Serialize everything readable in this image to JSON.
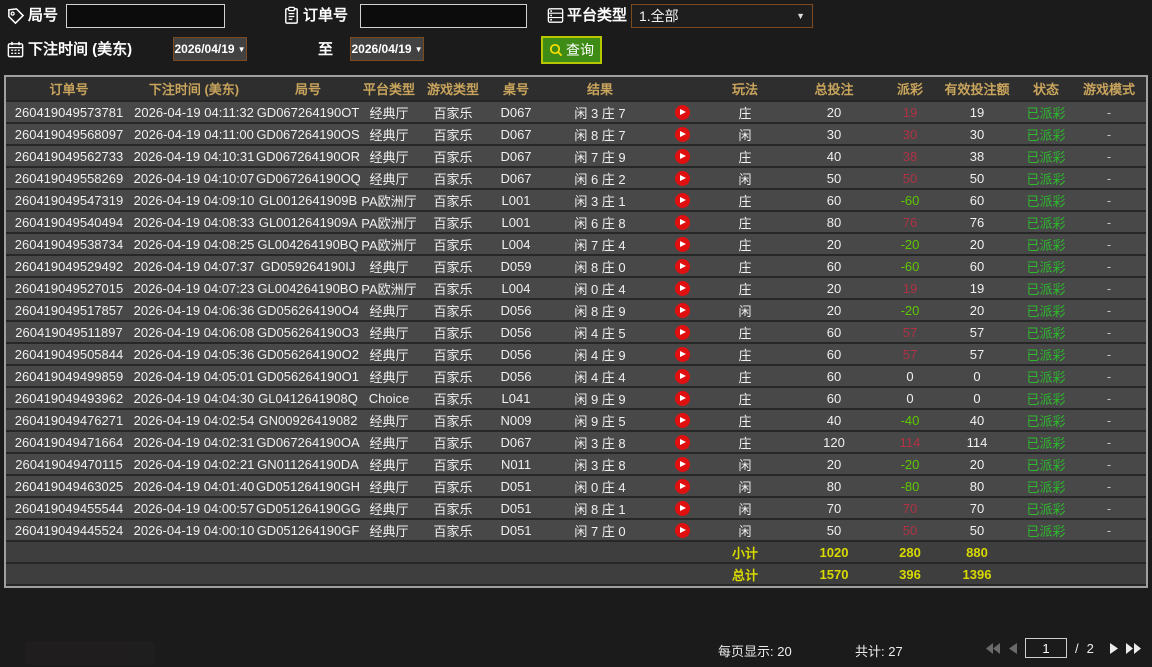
{
  "filters": {
    "game_no_label": "局号",
    "order_no_label": "订单号",
    "platform_label": "平台类型",
    "platform_value": "1.全部",
    "bet_time_label": "下注时间 (美东)",
    "date_from": "2026/04/19",
    "to_label": "至",
    "date_to": "2026/04/19",
    "query_label": "查询"
  },
  "table": {
    "columns": [
      "订单号",
      "下注时间 (美东)",
      "局号",
      "平台类型",
      "游戏类型",
      "桌号",
      "结果",
      "",
      "玩法",
      "总投注",
      "派彩",
      "有效投注额",
      "状态",
      "游戏模式"
    ],
    "rows": [
      {
        "order": "260419049573781",
        "time": "2026-04-19 04:11:32",
        "round": "GD067264190OT",
        "platform": "经典厅",
        "game": "百家乐",
        "table_no": "D067",
        "result": "闲 3 庄 7",
        "side": "庄",
        "bet": "20",
        "payout": "19",
        "valid": "19",
        "status": "已派彩",
        "mode": "-"
      },
      {
        "order": "260419049568097",
        "time": "2026-04-19 04:11:00",
        "round": "GD067264190OS",
        "platform": "经典厅",
        "game": "百家乐",
        "table_no": "D067",
        "result": "闲 8 庄 7",
        "side": "闲",
        "bet": "30",
        "payout": "30",
        "valid": "30",
        "status": "已派彩",
        "mode": "-"
      },
      {
        "order": "260419049562733",
        "time": "2026-04-19 04:10:31",
        "round": "GD067264190OR",
        "platform": "经典厅",
        "game": "百家乐",
        "table_no": "D067",
        "result": "闲 7 庄 9",
        "side": "庄",
        "bet": "40",
        "payout": "38",
        "valid": "38",
        "status": "已派彩",
        "mode": "-"
      },
      {
        "order": "260419049558269",
        "time": "2026-04-19 04:10:07",
        "round": "GD067264190OQ",
        "platform": "经典厅",
        "game": "百家乐",
        "table_no": "D067",
        "result": "闲 6 庄 2",
        "side": "闲",
        "bet": "50",
        "payout": "50",
        "valid": "50",
        "status": "已派彩",
        "mode": "-"
      },
      {
        "order": "260419049547319",
        "time": "2026-04-19 04:09:10",
        "round": "GL0012641909B",
        "platform": "PA欧洲厅",
        "game": "百家乐",
        "table_no": "L001",
        "result": "闲 3 庄 1",
        "side": "庄",
        "bet": "60",
        "payout": "-60",
        "valid": "60",
        "status": "已派彩",
        "mode": "-"
      },
      {
        "order": "260419049540494",
        "time": "2026-04-19 04:08:33",
        "round": "GL0012641909A",
        "platform": "PA欧洲厅",
        "game": "百家乐",
        "table_no": "L001",
        "result": "闲 6 庄 8",
        "side": "庄",
        "bet": "80",
        "payout": "76",
        "valid": "76",
        "status": "已派彩",
        "mode": "-"
      },
      {
        "order": "260419049538734",
        "time": "2026-04-19 04:08:25",
        "round": "GL004264190BQ",
        "platform": "PA欧洲厅",
        "game": "百家乐",
        "table_no": "L004",
        "result": "闲 7 庄 4",
        "side": "庄",
        "bet": "20",
        "payout": "-20",
        "valid": "20",
        "status": "已派彩",
        "mode": "-"
      },
      {
        "order": "260419049529492",
        "time": "2026-04-19 04:07:37",
        "round": "GD059264190IJ",
        "platform": "经典厅",
        "game": "百家乐",
        "table_no": "D059",
        "result": "闲 8 庄 0",
        "side": "庄",
        "bet": "60",
        "payout": "-60",
        "valid": "60",
        "status": "已派彩",
        "mode": "-"
      },
      {
        "order": "260419049527015",
        "time": "2026-04-19 04:07:23",
        "round": "GL004264190BO",
        "platform": "PA欧洲厅",
        "game": "百家乐",
        "table_no": "L004",
        "result": "闲 0 庄 4",
        "side": "庄",
        "bet": "20",
        "payout": "19",
        "valid": "19",
        "status": "已派彩",
        "mode": "-"
      },
      {
        "order": "260419049517857",
        "time": "2026-04-19 04:06:36",
        "round": "GD056264190O4",
        "platform": "经典厅",
        "game": "百家乐",
        "table_no": "D056",
        "result": "闲 8 庄 9",
        "side": "闲",
        "bet": "20",
        "payout": "-20",
        "valid": "20",
        "status": "已派彩",
        "mode": "-"
      },
      {
        "order": "260419049511897",
        "time": "2026-04-19 04:06:08",
        "round": "GD056264190O3",
        "platform": "经典厅",
        "game": "百家乐",
        "table_no": "D056",
        "result": "闲 4 庄 5",
        "side": "庄",
        "bet": "60",
        "payout": "57",
        "valid": "57",
        "status": "已派彩",
        "mode": "-"
      },
      {
        "order": "260419049505844",
        "time": "2026-04-19 04:05:36",
        "round": "GD056264190O2",
        "platform": "经典厅",
        "game": "百家乐",
        "table_no": "D056",
        "result": "闲 4 庄 9",
        "side": "庄",
        "bet": "60",
        "payout": "57",
        "valid": "57",
        "status": "已派彩",
        "mode": "-"
      },
      {
        "order": "260419049499859",
        "time": "2026-04-19 04:05:01",
        "round": "GD056264190O1",
        "platform": "经典厅",
        "game": "百家乐",
        "table_no": "D056",
        "result": "闲 4 庄 4",
        "side": "庄",
        "bet": "60",
        "payout": "0",
        "valid": "0",
        "status": "已派彩",
        "mode": "-"
      },
      {
        "order": "260419049493962",
        "time": "2026-04-19 04:04:30",
        "round": "GL0412641908Q",
        "platform": "Choice",
        "game": "百家乐",
        "table_no": "L041",
        "result": "闲 9 庄 9",
        "side": "庄",
        "bet": "60",
        "payout": "0",
        "valid": "0",
        "status": "已派彩",
        "mode": "-"
      },
      {
        "order": "260419049476271",
        "time": "2026-04-19 04:02:54",
        "round": "GN00926419082",
        "platform": "经典厅",
        "game": "百家乐",
        "table_no": "N009",
        "result": "闲 9 庄 5",
        "side": "庄",
        "bet": "40",
        "payout": "-40",
        "valid": "40",
        "status": "已派彩",
        "mode": "-"
      },
      {
        "order": "260419049471664",
        "time": "2026-04-19 04:02:31",
        "round": "GD067264190OA",
        "platform": "经典厅",
        "game": "百家乐",
        "table_no": "D067",
        "result": "闲 3 庄 8",
        "side": "庄",
        "bet": "120",
        "payout": "114",
        "valid": "114",
        "status": "已派彩",
        "mode": "-"
      },
      {
        "order": "260419049470115",
        "time": "2026-04-19 04:02:21",
        "round": "GN011264190DA",
        "platform": "经典厅",
        "game": "百家乐",
        "table_no": "N011",
        "result": "闲 3 庄 8",
        "side": "闲",
        "bet": "20",
        "payout": "-20",
        "valid": "20",
        "status": "已派彩",
        "mode": "-"
      },
      {
        "order": "260419049463025",
        "time": "2026-04-19 04:01:40",
        "round": "GD051264190GH",
        "platform": "经典厅",
        "game": "百家乐",
        "table_no": "D051",
        "result": "闲 0 庄 4",
        "side": "闲",
        "bet": "80",
        "payout": "-80",
        "valid": "80",
        "status": "已派彩",
        "mode": "-"
      },
      {
        "order": "260419049455544",
        "time": "2026-04-19 04:00:57",
        "round": "GD051264190GG",
        "platform": "经典厅",
        "game": "百家乐",
        "table_no": "D051",
        "result": "闲 8 庄 1",
        "side": "闲",
        "bet": "70",
        "payout": "70",
        "valid": "70",
        "status": "已派彩",
        "mode": "-"
      },
      {
        "order": "260419049445524",
        "time": "2026-04-19 04:00:10",
        "round": "GD051264190GF",
        "platform": "经典厅",
        "game": "百家乐",
        "table_no": "D051",
        "result": "闲 7 庄 0",
        "side": "闲",
        "bet": "50",
        "payout": "50",
        "valid": "50",
        "status": "已派彩",
        "mode": "-"
      }
    ],
    "subtotal": {
      "label": "小计",
      "bet": "1020",
      "payout": "280",
      "valid": "880"
    },
    "total": {
      "label": "总计",
      "bet": "1570",
      "payout": "396",
      "valid": "1396"
    }
  },
  "footer": {
    "page_size_label": "每页显示: 20",
    "total_count_label": "共计: 27",
    "page_current": "1",
    "page_separator": "/",
    "page_total": "2"
  },
  "colors": {
    "accent_gold": "#c8a45c",
    "payout_positive": "#b03245",
    "payout_negative": "#5ec900",
    "status_green": "#2eb82e",
    "total_yellow": "#d9d900",
    "query_green": "#3e8c15",
    "query_border": "#b8c800"
  }
}
